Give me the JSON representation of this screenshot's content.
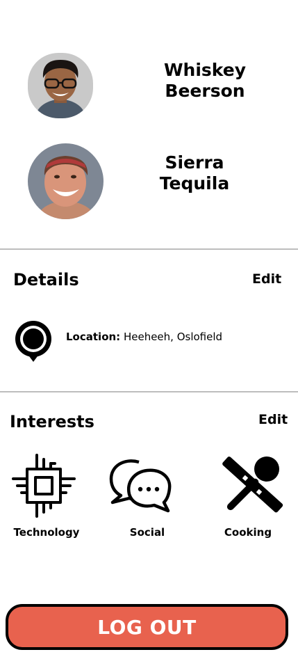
{
  "profiles": [
    {
      "name_line1": "Whiskey",
      "name_line2": "Beerson",
      "avatar_bg": "#c9c9c9"
    },
    {
      "name_line1": "Sierra",
      "name_line2": "Tequila",
      "avatar_bg": "#7e8794"
    }
  ],
  "details": {
    "title": "Details",
    "edit_label": "Edit",
    "location_label": "Location:",
    "location_value": "Heeheeh, Oslofield",
    "icon": "map-pin-icon"
  },
  "interests": {
    "title": "Interests",
    "edit_label": "Edit",
    "items": [
      {
        "label": "Technology",
        "icon": "chip-icon"
      },
      {
        "label": "Social",
        "icon": "chat-bubbles-icon"
      },
      {
        "label": "Cooking",
        "icon": "cooking-utensils-icon"
      }
    ]
  },
  "logout": {
    "label": "LOG OUT",
    "color": "#e8624e"
  }
}
